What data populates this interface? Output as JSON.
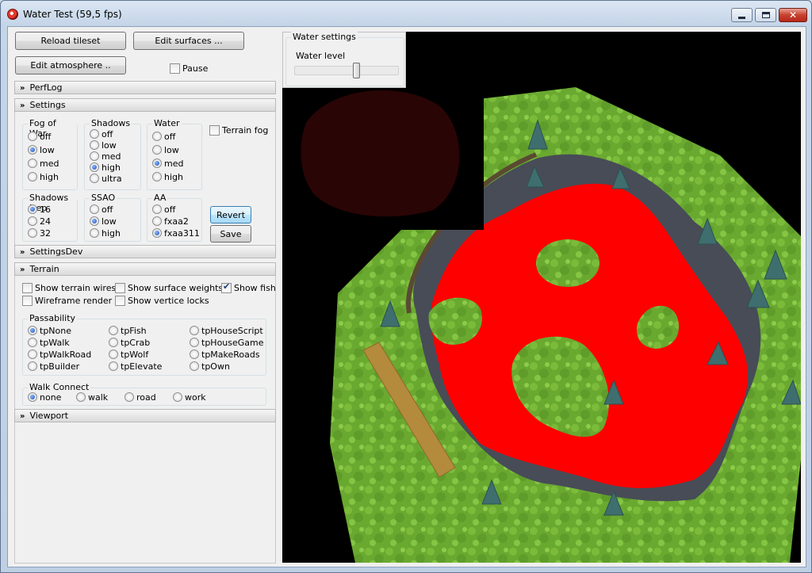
{
  "window": {
    "title": "Water Test (59,5 fps)",
    "close_glyph": "✕"
  },
  "toolbar": {
    "reload_tileset": "Reload tileset",
    "edit_surfaces": "Edit surfaces ...",
    "edit_atmosphere": "Edit atmosphere ..",
    "pause_label": "Pause",
    "pause_checked": false
  },
  "sections": {
    "perflog": "PerfLog",
    "settings": "Settings",
    "settingsdev": "SettingsDev",
    "terrain": "Terrain",
    "viewport": "Viewport",
    "chevron": "»"
  },
  "settings": {
    "fog_of_war": {
      "title": "Fog of War",
      "options": [
        "off",
        "low",
        "med",
        "high"
      ],
      "selected": "low"
    },
    "shadows": {
      "title": "Shadows",
      "options": [
        "off",
        "low",
        "med",
        "high",
        "ultra"
      ],
      "selected": "high"
    },
    "water": {
      "title": "Water",
      "options": [
        "off",
        "low",
        "med",
        "high"
      ],
      "selected": "med"
    },
    "terrain_fog": {
      "label": "Terrain fog",
      "checked": false
    },
    "shadows_depth": {
      "title": "Shadows Dep",
      "options": [
        "16",
        "24",
        "32"
      ],
      "selected": "16"
    },
    "ssao": {
      "title": "SSAO",
      "options": [
        "off",
        "low",
        "high"
      ],
      "selected": "low"
    },
    "aa": {
      "title": "AA",
      "options": [
        "off",
        "fxaa2",
        "fxaa311"
      ],
      "selected": "fxaa311"
    },
    "revert": "Revert",
    "save": "Save"
  },
  "terrain": {
    "show_terrain_wires": {
      "label": "Show terrain wires",
      "checked": false
    },
    "show_surface_weights": {
      "label": "Show surface weights",
      "checked": false
    },
    "show_fish": {
      "label": "Show fish",
      "checked": true
    },
    "wireframe_render": {
      "label": "Wireframe render",
      "checked": false
    },
    "show_vertice_locks": {
      "label": "Show vertice locks",
      "checked": false
    },
    "passability": {
      "title": "Passability",
      "options": [
        "tpNone",
        "tpWalk",
        "tpWalkRoad",
        "tpBuilder",
        "tpFish",
        "tpCrab",
        "tpWolf",
        "tpElevate",
        "tpHouseScript",
        "tpHouseGame",
        "tpMakeRoads",
        "tpOwn"
      ],
      "selected": "tpNone"
    },
    "walk_connect": {
      "title": "Walk Connect",
      "options": [
        "none",
        "walk",
        "road",
        "work"
      ],
      "selected": "none"
    }
  },
  "water_settings": {
    "title": "Water settings",
    "water_level_label": "Water level",
    "water_level": 0.6
  },
  "colors": {
    "water_red": "#ff0000",
    "grass": "#6fb232",
    "background": "#000000"
  }
}
